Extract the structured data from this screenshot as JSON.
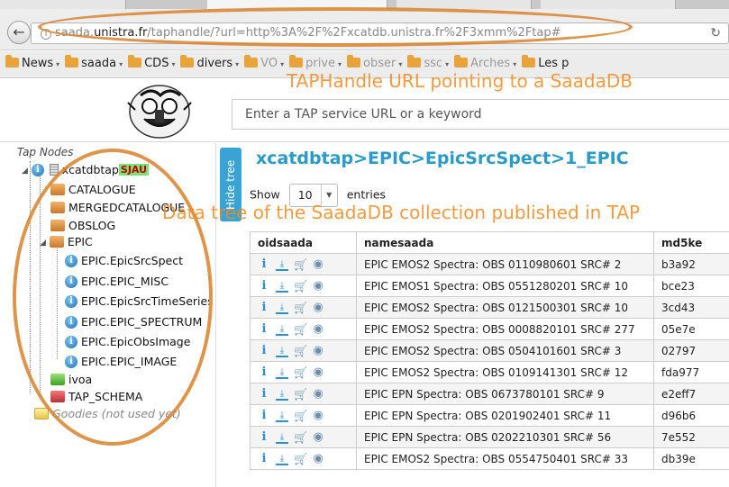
{
  "browser": {
    "url_host": "saada.",
    "url_domain": "unistra.fr",
    "url_path": "/taphandle/?url=http%3A%2F%2Fxcatdb.unistra.fr%2F3xmm%2Ftap#",
    "reload_icon": "reload-icon",
    "bookmarks": [
      {
        "label": "News",
        "faded": false
      },
      {
        "label": "saada",
        "faded": false
      },
      {
        "label": "CDS",
        "faded": false
      },
      {
        "label": "divers",
        "faded": false
      },
      {
        "label": "VO",
        "faded": true
      },
      {
        "label": "prive",
        "faded": true
      },
      {
        "label": "obser",
        "faded": true
      },
      {
        "label": "ssc",
        "faded": true
      },
      {
        "label": "Arches",
        "faded": true
      },
      {
        "label": "Les p",
        "faded": false
      }
    ]
  },
  "search": {
    "placeholder": "Enter a TAP service URL or a keyword"
  },
  "tree": {
    "title": "Tap Nodes",
    "root": {
      "label": "xcatdbtap",
      "badge": "SJAU"
    },
    "schemas": {
      "catalogue": "CATALOGUE",
      "mergedcatalogue": "MERGEDCATALOGUE",
      "obslog": "OBSLOG",
      "epic": "EPIC",
      "ivoa": "ivoa",
      "tap_schema": "TAP_SCHEMA"
    },
    "epic_tables": [
      "EPIC.EpicSrcSpect",
      "EPIC.EPIC_MISC",
      "EPIC.EpicSrcTimeSeries",
      "EPIC.EPIC_SPECTRUM",
      "EPIC.EpicObsImage",
      "EPIC.EPIC_IMAGE"
    ],
    "goodies": "Goodies (not used yet)"
  },
  "hide_tree_label": "Hide tree",
  "breadcrumb": "xcatdbtap>EPIC>EpicSrcSpect>1_EPIC",
  "pager": {
    "show": "Show",
    "entries": "entries",
    "value": "10"
  },
  "table": {
    "columns": [
      "oidsaada",
      "namesaada",
      "md5ke"
    ],
    "rows": [
      {
        "name": "EPIC EMOS2 Spectra: OBS 0110980601 SRC# 2",
        "md5": "b3a92"
      },
      {
        "name": "EPIC EMOS1 Spectra: OBS 0551280201 SRC# 10",
        "md5": "bce23"
      },
      {
        "name": "EPIC EMOS2 Spectra: OBS 0121500301 SRC# 10",
        "md5": "3cd43"
      },
      {
        "name": "EPIC EMOS2 Spectra: OBS 0008820101 SRC# 277",
        "md5": "05e7e"
      },
      {
        "name": "EPIC EMOS2 Spectra: OBS 0504101601 SRC# 3",
        "md5": "02797"
      },
      {
        "name": "EPIC EMOS2 Spectra: OBS 0109141301 SRC# 12",
        "md5": "fda977"
      },
      {
        "name": "EPIC EPN Spectra: OBS 0673780101 SRC# 9",
        "md5": "e2eff7"
      },
      {
        "name": "EPIC EPN Spectra: OBS 0201902401 SRC# 11",
        "md5": "d96b6"
      },
      {
        "name": "EPIC EPN Spectra: OBS 0202210301 SRC# 56",
        "md5": "7e552"
      },
      {
        "name": "EPIC EMOS2 Spectra: OBS 0554750401 SRC# 33",
        "md5": "db39e"
      }
    ]
  },
  "annotations": {
    "url_note": "TAPHandle URL pointing to a SaadaDB",
    "tree_note": "Data tree of the SaadaDB collection published in TAP",
    "color": "#f08a20"
  }
}
